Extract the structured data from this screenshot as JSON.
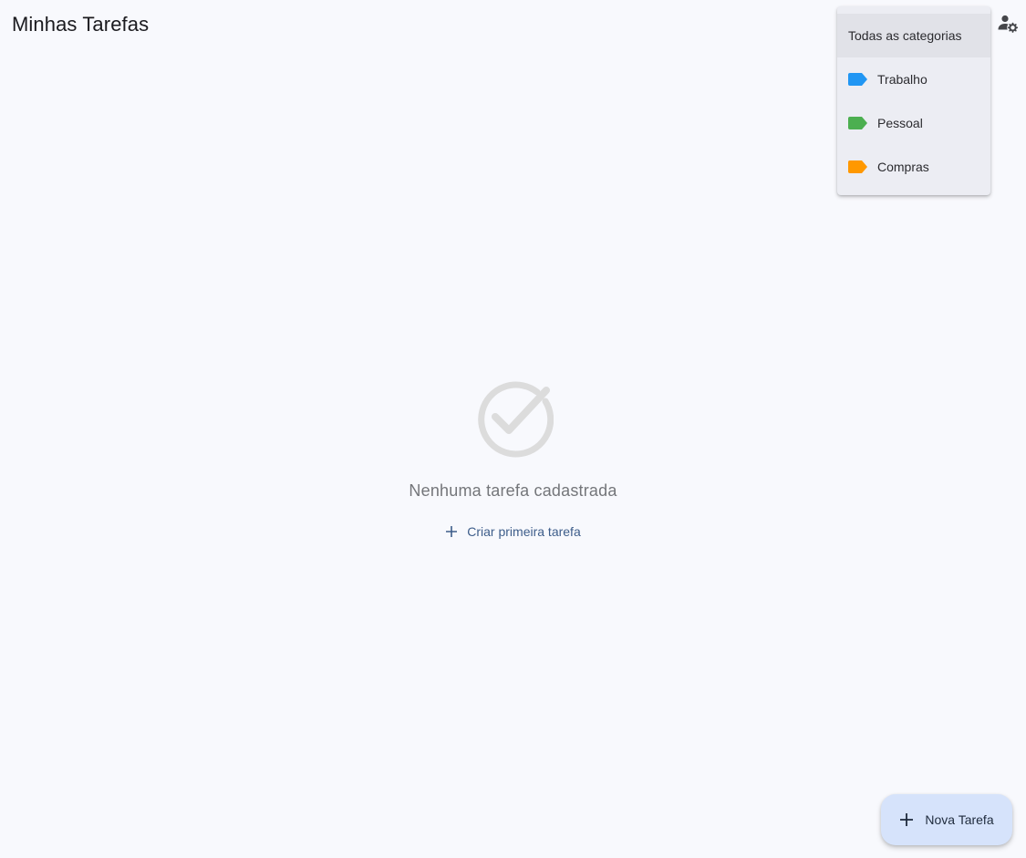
{
  "header": {
    "title": "Minhas Tarefas",
    "account_icon": "manage-accounts-icon"
  },
  "category_menu": {
    "items": [
      {
        "label": "Todas as categorias",
        "selected": true
      },
      {
        "label": "Trabalho",
        "color": "#2196f3",
        "icon": "label-icon"
      },
      {
        "label": "Pessoal",
        "color": "#4caf50",
        "icon": "label-icon"
      },
      {
        "label": "Compras",
        "color": "#ff9800",
        "icon": "label-icon"
      }
    ]
  },
  "empty_state": {
    "icon": "check-circle-icon",
    "message": "Nenhuma tarefa cadastrada",
    "create_label": "Criar primeira tarefa"
  },
  "fab": {
    "label": "Nova Tarefa",
    "icon": "plus-icon"
  }
}
